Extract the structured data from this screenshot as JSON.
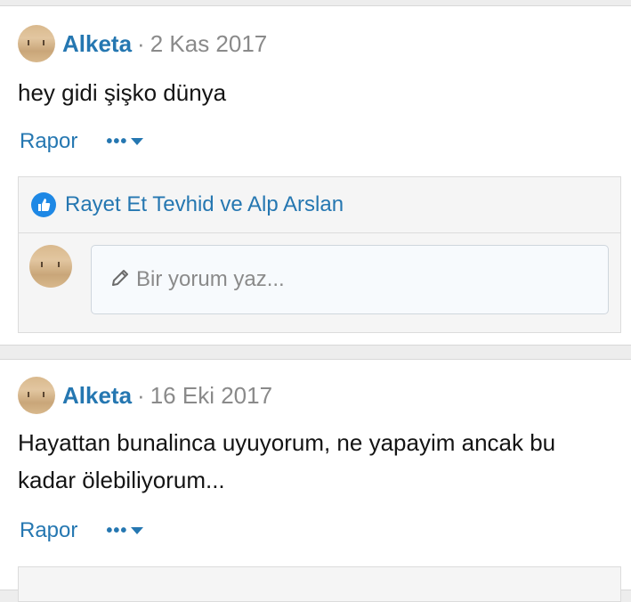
{
  "posts": [
    {
      "author": "Alketa",
      "separator": "·",
      "date": "2 Kas 2017",
      "text": "hey gidi şişko dünya",
      "report_label": "Rapor",
      "more_label": "•••",
      "likes_text": "Rayet Et Tevhid ve Alp Arslan",
      "comment_placeholder": "Bir yorum yaz..."
    },
    {
      "author": "Alketa",
      "separator": "·",
      "date": "16 Eki 2017",
      "text": "Hayattan bunalinca uyuyorum, ne yapayim ancak bu kadar ölebiliyorum...",
      "report_label": "Rapor",
      "more_label": "•••"
    }
  ],
  "icons": {
    "like": "thumbs-up-icon",
    "pencil": "pencil-icon",
    "dropdown": "chevron-down-icon"
  },
  "colors": {
    "link": "#2577b1",
    "like_badge": "#1e88e5",
    "muted": "#8a8a8a"
  }
}
